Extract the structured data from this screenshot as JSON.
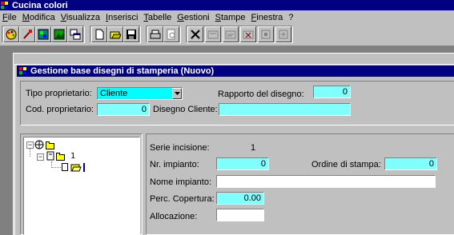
{
  "app": {
    "title": "Cucina colori"
  },
  "menu": [
    "File",
    "Modifica",
    "Visualizza",
    "Inserisci",
    "Tabelle",
    "Gestioni",
    "Stampe",
    "Finestra",
    "?"
  ],
  "toolbar": {
    "group1": [
      "palette-icon",
      "brush-icon",
      "grid-icon",
      "image-icon",
      "windows-icon"
    ],
    "group2": [
      "new-document-icon",
      "open-folder-icon",
      "save-icon"
    ],
    "group3": [
      "print-icon",
      "print-preview-icon"
    ],
    "group4": [
      "delete-icon",
      "tool-icon-1",
      "tool-icon-2",
      "tool-icon-3",
      "tool-icon-4",
      "tool-icon-5"
    ]
  },
  "window": {
    "title": "Gestione base disegni di stamperia (Nuovo)",
    "tipo_proprietario_label": "Tipo proprietario:",
    "tipo_proprietario_value": "Cliente",
    "rapporto_label": "Rapporto del disegno:",
    "rapporto_value": "0",
    "cod_proprietario_label": "Cod. proprietario:",
    "cod_proprietario_value": "0",
    "disegno_cliente_label": "Disegno Cliente:",
    "disegno_cliente_value": "",
    "tree": {
      "node_label": "1"
    },
    "serie_label": "Serie incisione:",
    "serie_value": "1",
    "nr_impianto_label": "Nr. impianto:",
    "nr_impianto_value": "0",
    "ordine_label": "Ordine di stampa:",
    "ordine_value": "0",
    "nome_impianto_label": "Nome impianto:",
    "nome_impianto_value": "",
    "perc_copertura_label": "Perc. Copertura:",
    "perc_copertura_value": "0.00",
    "allocazione_label": "Allocazione:",
    "allocazione_value": ""
  },
  "colors": {
    "titlebar": "#000080",
    "face": "#c0c0c0",
    "field_cyan": "#80ffff",
    "workspace": "#808080"
  }
}
